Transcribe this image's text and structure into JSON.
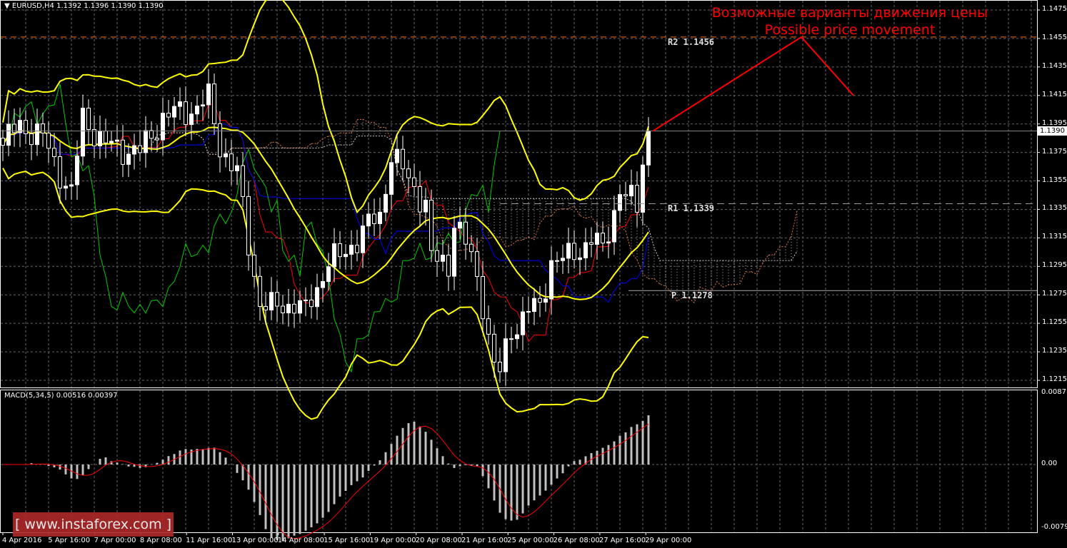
{
  "header": {
    "symbol": "EURUSD,H4",
    "ohlc": "1.1392 1.1396 1.1390 1.1390"
  },
  "macd_label": "MACD(5,34,5) 0.00516 0.00397",
  "annotation": {
    "ru": "Возможные варианты движения цены",
    "en": "Possible price movement"
  },
  "watermark": "[ www.instaforex.com ]",
  "current_price": "1.1390",
  "pivots": [
    {
      "label": "R2 1.1456",
      "value": 1.1456
    },
    {
      "label": "R1 1.1339",
      "value": 1.1339
    },
    {
      "label": "P 1.1278",
      "value": 1.1278
    }
  ],
  "chart_data": {
    "type": "candlestick",
    "title": "EURUSD,H4",
    "price_ticks": [
      "1.1475",
      "1.1455",
      "1.1435",
      "1.1415",
      "1.1395",
      "1.1375",
      "1.1355",
      "1.1335",
      "1.1315",
      "1.1295",
      "1.1275",
      "1.1255",
      "1.1235",
      "1.1215"
    ],
    "ylim": [
      1.121,
      1.1478
    ],
    "macd_ticks": [
      "0.0087",
      "0.00",
      "-0.00798"
    ],
    "macd_ylim": [
      -0.00798,
      0.0087
    ],
    "x_labels": [
      "4 Apr 2016",
      "5 Apr 16:00",
      "7 Apr 00:00",
      "8 Apr 08:00",
      "11 Apr 16:00",
      "13 Apr 00:00",
      "14 Apr 08:00",
      "15 Apr 16:00",
      "19 Apr 00:00",
      "20 Apr 08:00",
      "21 Apr 16:00",
      "25 Apr 00:00",
      "26 Apr 08:00",
      "27 Apr 16:00",
      "29 Apr 00:00"
    ],
    "bars": 114,
    "close_keypoints": [
      [
        0,
        1.138
      ],
      [
        3,
        1.1395
      ],
      [
        7,
        1.1385
      ],
      [
        12,
        1.1345
      ],
      [
        14,
        1.14
      ],
      [
        18,
        1.138
      ],
      [
        24,
        1.1375
      ],
      [
        28,
        1.14
      ],
      [
        33,
        1.1405
      ],
      [
        36,
        1.1412
      ],
      [
        38,
        1.138
      ],
      [
        41,
        1.136
      ],
      [
        43,
        1.131
      ],
      [
        45,
        1.127
      ],
      [
        47,
        1.1265
      ],
      [
        51,
        1.127
      ],
      [
        53,
        1.1262
      ],
      [
        55,
        1.128
      ],
      [
        57,
        1.13
      ],
      [
        59,
        1.13
      ],
      [
        63,
        1.132
      ],
      [
        66,
        1.133
      ],
      [
        68,
        1.1375
      ],
      [
        71,
        1.1355
      ],
      [
        74,
        1.134
      ],
      [
        75,
        1.13
      ],
      [
        78,
        1.1295
      ],
      [
        79,
        1.133
      ],
      [
        82,
        1.13
      ],
      [
        84,
        1.127
      ],
      [
        86,
        1.1225
      ],
      [
        87,
        1.122
      ],
      [
        89,
        1.125
      ],
      [
        92,
        1.1265
      ],
      [
        94,
        1.1265
      ],
      [
        96,
        1.13
      ],
      [
        99,
        1.13
      ],
      [
        103,
        1.1315
      ],
      [
        105,
        1.1305
      ],
      [
        108,
        1.135
      ],
      [
        111,
        1.1335
      ],
      [
        112,
        1.137
      ],
      [
        113,
        1.139
      ]
    ],
    "projection": [
      [
        1.139
      ],
      [
        1.1456
      ],
      [
        1.1415
      ]
    ],
    "colors": {
      "bollinger": "#ffff00",
      "tenkan": "#ff0000",
      "kijun": "#0000ff",
      "chikou": "#00cc00",
      "cloud": "#ffffff",
      "macd_signal": "#ff0000",
      "macd_hist": "#c0c0c0",
      "projection": "#ff0000",
      "r2": "#ff6a00"
    }
  }
}
